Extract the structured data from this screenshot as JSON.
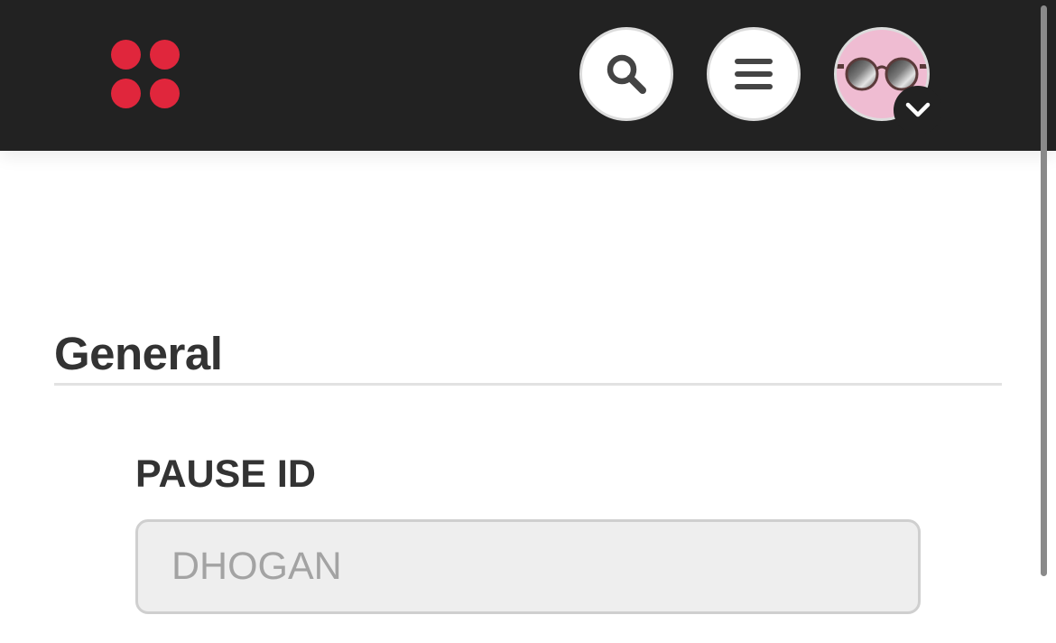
{
  "header": {
    "background": "#222222",
    "logo": {
      "icon": "four-dots-logo",
      "color": "#e0263c"
    },
    "search_button": {
      "icon": "search-icon"
    },
    "menu_button": {
      "icon": "hamburger-menu-icon"
    },
    "avatar": {
      "icon": "sunglasses-avatar",
      "background": "#efbcd2"
    },
    "avatar_dropdown": {
      "icon": "chevron-down-icon"
    }
  },
  "main": {
    "section_title": "General",
    "fields": [
      {
        "label": "PAUSE ID",
        "value": "DHOGAN",
        "disabled": true
      }
    ]
  }
}
